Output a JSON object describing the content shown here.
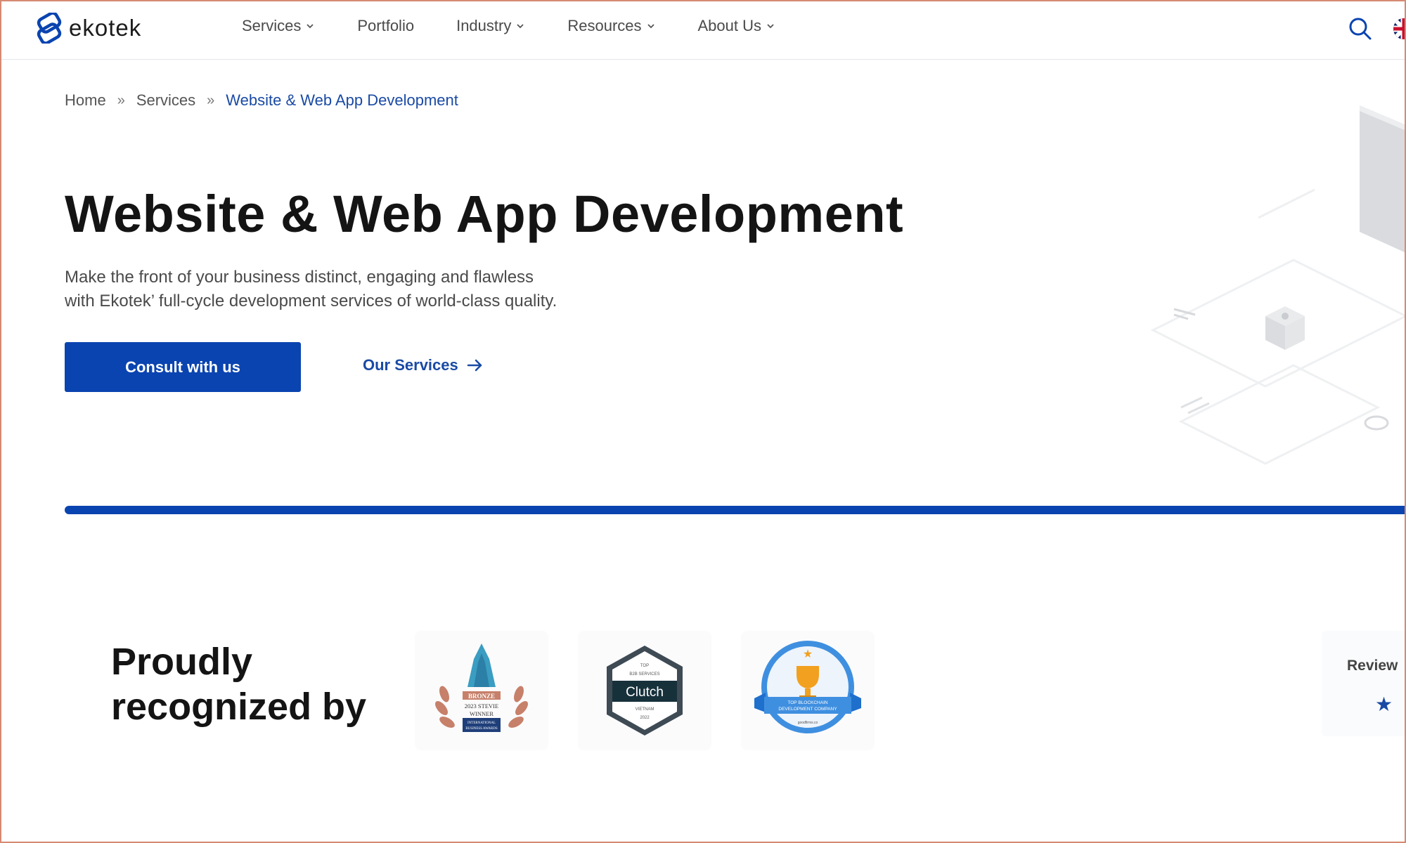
{
  "header": {
    "logo_text": "ekotek",
    "nav": [
      {
        "label": "Services",
        "has_dropdown": true
      },
      {
        "label": "Portfolio",
        "has_dropdown": false
      },
      {
        "label": "Industry",
        "has_dropdown": true
      },
      {
        "label": "Resources",
        "has_dropdown": true
      },
      {
        "label": "About Us",
        "has_dropdown": true
      }
    ],
    "icons": {
      "search": "search-icon",
      "language": "uk-flag-icon"
    }
  },
  "breadcrumb": {
    "items": [
      "Home",
      "Services"
    ],
    "separator": "»",
    "current": "Website & Web App Development"
  },
  "hero": {
    "title": "Website & Web App Development",
    "description_lines": [
      "Make the front of your business distinct, engaging and flawless",
      "with Ekotek’ full-cycle development services of world-class quality."
    ],
    "primary_button": "Consult with us",
    "secondary_link": "Our Services"
  },
  "recognition": {
    "title_lines": [
      "Proudly",
      "recognized by"
    ],
    "badges": [
      {
        "name": "stevie-award-badge",
        "lines": [
          "BRONZE",
          "2023 STEVIE",
          "WINNER",
          "INTERNATIONAL",
          "BUSINESS AWARDS"
        ]
      },
      {
        "name": "clutch-badge",
        "lines": [
          "TOP",
          "B2B SERVICES",
          "Clutch",
          "VIETNAM",
          "2022"
        ]
      },
      {
        "name": "goodfirms-badge",
        "lines": [
          "TOP BLOCKCHAIN",
          "DEVELOPMENT COMPANY",
          "goodfirms.co"
        ]
      }
    ],
    "review": {
      "label": "Review",
      "star": "★"
    }
  },
  "colors": {
    "brand_blue": "#0a44b0",
    "link_blue": "#1a4aa5",
    "frame_border": "#d58a72"
  }
}
